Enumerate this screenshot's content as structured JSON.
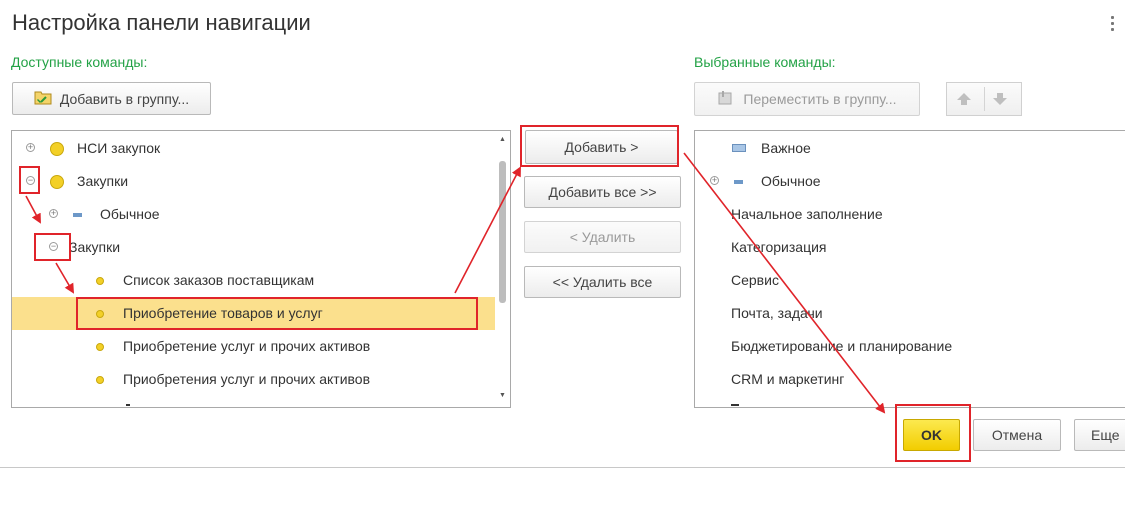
{
  "window": {
    "title": "Настройка панели навигации"
  },
  "left": {
    "label": "Доступные команды:",
    "add_to_group": "Добавить в группу...",
    "tree": [
      {
        "label": "НСИ закупок"
      },
      {
        "label": "Закупки"
      },
      {
        "label": "Обычное"
      },
      {
        "label": "Закупки"
      },
      {
        "label": "Список заказов поставщикам"
      },
      {
        "label": "Приобретение товаров и услуг"
      },
      {
        "label": "Приобретение услуг и прочих активов"
      },
      {
        "label": "Приобретения услуг и прочих активов"
      }
    ]
  },
  "middle": {
    "add": "Добавить >",
    "add_all": "Добавить все >>",
    "remove": "< Удалить",
    "remove_all": "<< Удалить все"
  },
  "right": {
    "label": "Выбранные команды:",
    "move_to_group": "Переместить в группу...",
    "list": [
      {
        "label": "Важное"
      },
      {
        "label": "Обычное"
      },
      {
        "label": "Начальное заполнение"
      },
      {
        "label": "Категоризация"
      },
      {
        "label": "Сервис"
      },
      {
        "label": "Почта, задачи"
      },
      {
        "label": "Бюджетирование и планирование"
      },
      {
        "label": "CRM и маркетинг"
      }
    ]
  },
  "footer": {
    "ok": "OK",
    "cancel": "Отмена",
    "more": "Еще"
  },
  "colors": {
    "accent_green": "#23a246",
    "selection": "#fbe08d",
    "annotation_red": "#e0242a",
    "ok_yellow": "#f2cd00"
  }
}
